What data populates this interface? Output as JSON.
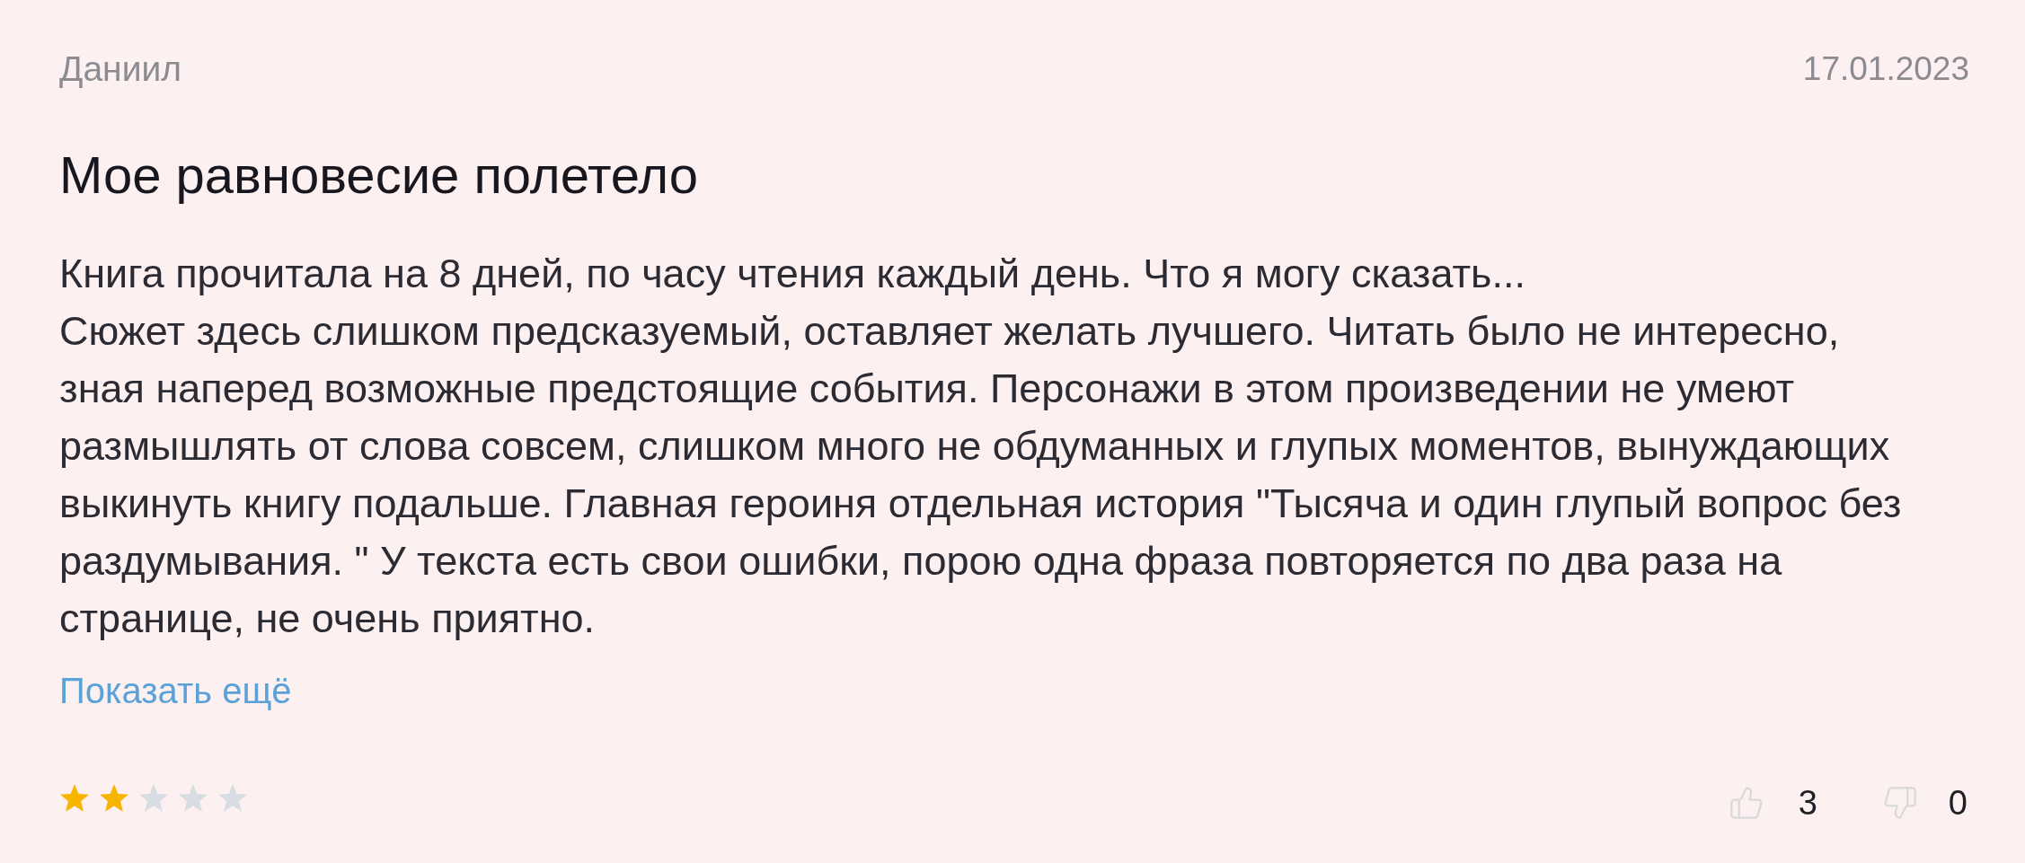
{
  "review": {
    "author": "Даниил",
    "date": "17.01.2023",
    "title": "Мое равновесие полетело",
    "text": "Книга прочитала на 8 дней, по часу чтения каждый день. Что я могу сказать...\nСюжет здесь слишком предсказуемый, оставляет желать лучшего. Читать было не интересно,\nзная наперед возможные предстоящие события. Персонажи в этом произведении не умеют\nразмышлять от слова совсем, слишком много не обдуманных и глупых моментов, вынуждающих\nвыкинуть книгу подальше. Главная героиня отдельная история \"Тысяча и один глупый вопрос без\nраздумывания. \" У текста есть свои ошибки, порою одна фраза повторяется по два раза на\nстранице, не очень приятно.",
    "show_more": "Показать ещё",
    "stars": 2,
    "likes": "3",
    "dislikes": "0"
  }
}
